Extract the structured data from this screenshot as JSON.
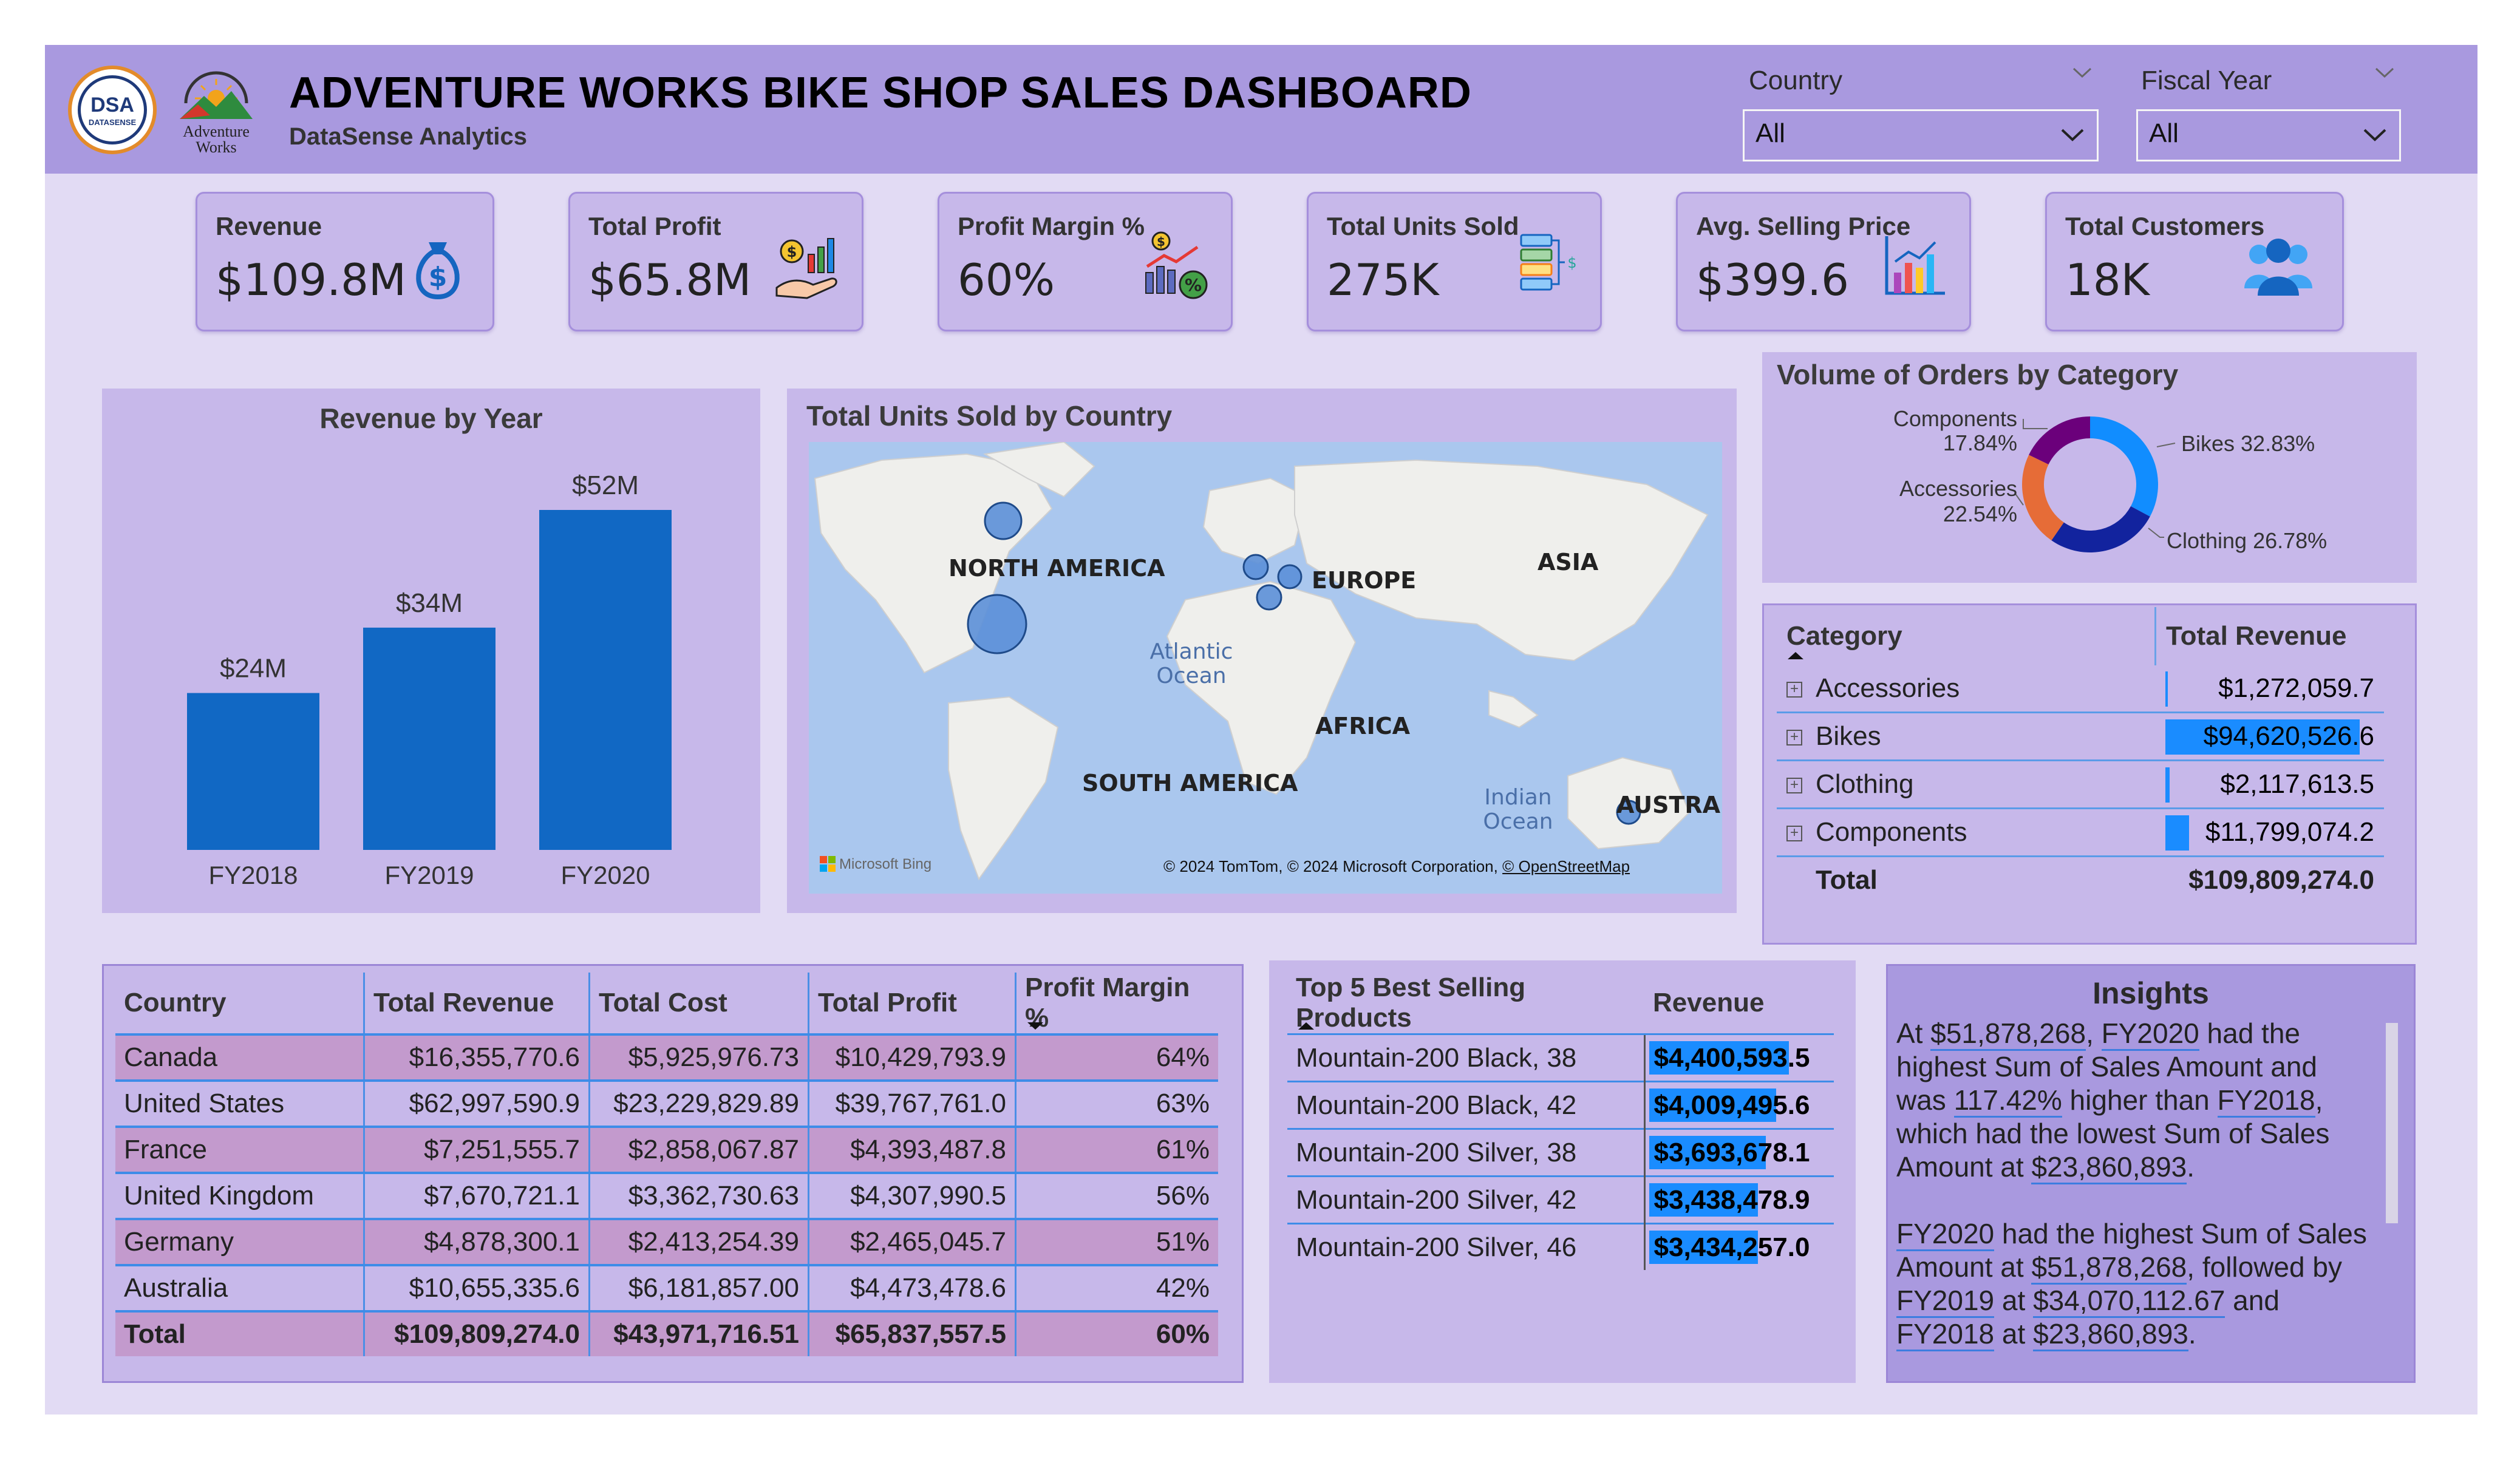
{
  "header": {
    "title": "ADVENTURE WORKS BIKE SHOP SALES DASHBOARD",
    "subtitle": "DataSense Analytics",
    "logo_dsa_text": "DSA",
    "logo_dsa_sub": "DATASENSE",
    "logo_aw_line1": "Adventure",
    "logo_aw_line2": "Works"
  },
  "slicers": {
    "country": {
      "label": "Country",
      "value": "All"
    },
    "fiscal_year": {
      "label": "Fiscal Year",
      "value": "All"
    }
  },
  "kpis": [
    {
      "label": "Revenue",
      "value": "$109.8M",
      "icon": "money-bag-icon"
    },
    {
      "label": "Total Profit",
      "value": "$65.8M",
      "icon": "profit-hand-icon"
    },
    {
      "label": "Profit Margin %",
      "value": "60%",
      "icon": "profit-margin-icon"
    },
    {
      "label": "Total Units Sold",
      "value": "275K",
      "icon": "units-stack-icon"
    },
    {
      "label": "Avg. Selling Price",
      "value": "$399.6",
      "icon": "bar-chart-icon"
    },
    {
      "label": "Total Customers",
      "value": "18K",
      "icon": "customers-icon"
    }
  ],
  "revenue_by_year": {
    "title": "Revenue by Year",
    "chart_data": {
      "type": "bar",
      "categories": [
        "FY2018",
        "FY2019",
        "FY2020"
      ],
      "values": [
        24,
        34,
        52
      ],
      "labels": [
        "$24M",
        "$34M",
        "$52M"
      ],
      "color": "#1168c4"
    }
  },
  "map": {
    "title": "Total Units Sold by Country",
    "labels": {
      "north_america": "NORTH AMERICA",
      "europe": "EUROPE",
      "asia": "ASIA",
      "africa": "AFRICA",
      "south_america": "SOUTH AMERICA",
      "australia": "AUSTRALI",
      "atlantic": "Atlantic Ocean",
      "indian": "Indian Ocean"
    },
    "attribution": "© 2024 TomTom, © 2024 Microsoft Corporation,",
    "attribution_link": "© OpenStreetMap",
    "brand": "Microsoft Bing"
  },
  "orders_by_category": {
    "title": "Volume of Orders by Category",
    "chart_data": {
      "type": "pie",
      "categories": [
        "Bikes",
        "Clothing",
        "Accessories",
        "Components"
      ],
      "values": [
        32.83,
        26.78,
        22.54,
        17.84
      ],
      "colors": [
        "#118dff",
        "#12239e",
        "#e66c37",
        "#6b007b"
      ]
    },
    "labels": {
      "bikes": "Bikes 32.83%",
      "clothing": "Clothing 26.78%",
      "accessories_name": "Accessories",
      "accessories_pct": "22.54%",
      "components_name": "Components",
      "components_pct": "17.84%"
    }
  },
  "category_table": {
    "headers": [
      "Category",
      "Total Revenue"
    ],
    "rows": [
      {
        "name": "Accessories",
        "value": "$1,272,059.7",
        "share": 1.34
      },
      {
        "name": "Bikes",
        "value": "$94,620,526.6",
        "share": 100
      },
      {
        "name": "Clothing",
        "value": "$2,117,613.5",
        "share": 2.24
      },
      {
        "name": "Components",
        "value": "$11,799,074.2",
        "share": 12.47
      }
    ],
    "total_label": "Total",
    "total_value": "$109,809,274.0"
  },
  "country_table": {
    "headers": [
      "Country",
      "Total Revenue",
      "Total Cost",
      "Total Profit",
      "Profit Margin %"
    ],
    "rows": [
      [
        "Canada",
        "$16,355,770.6",
        "$5,925,976.73",
        "$10,429,793.9",
        "64%"
      ],
      [
        "United States",
        "$62,997,590.9",
        "$23,229,829.89",
        "$39,767,761.0",
        "63%"
      ],
      [
        "France",
        "$7,251,555.7",
        "$2,858,067.87",
        "$4,393,487.8",
        "61%"
      ],
      [
        "United Kingdom",
        "$7,670,721.1",
        "$3,362,730.63",
        "$4,307,990.5",
        "56%"
      ],
      [
        "Germany",
        "$4,878,300.1",
        "$2,413,254.39",
        "$2,465,045.7",
        "51%"
      ],
      [
        "Australia",
        "$10,655,335.6",
        "$6,181,857.00",
        "$4,473,478.6",
        "42%"
      ]
    ],
    "total": [
      "Total",
      "$109,809,274.0",
      "$43,971,716.51",
      "$65,837,557.5",
      "60%"
    ]
  },
  "top_products": {
    "headers": [
      "Top 5 Best Selling Products",
      "Revenue"
    ],
    "rows": [
      {
        "name": "Mountain-200 Black, 38",
        "value": "$4,400,593.5",
        "share": 100
      },
      {
        "name": "Mountain-200 Black, 42",
        "value": "$4,009,495.6",
        "share": 91.1
      },
      {
        "name": "Mountain-200 Silver, 38",
        "value": "$3,693,678.1",
        "share": 83.9
      },
      {
        "name": "Mountain-200 Silver, 42",
        "value": "$3,438,478.9",
        "share": 78.1
      },
      {
        "name": "Mountain-200 Silver, 46",
        "value": "$3,434,257.0",
        "share": 78.0
      }
    ]
  },
  "insights": {
    "title": "Insights",
    "p1": {
      "a": "At ",
      "v1": "$51,878,268",
      "b": ", ",
      "v2": "FY2020",
      "c": " had the highest Sum of Sales Amount and was ",
      "v3": "117.42%",
      "d": " higher than ",
      "v4": "FY2018",
      "e": ", which had the lowest Sum of Sales Amount at ",
      "v5": "$23,860,893",
      "f": "."
    },
    "p2": {
      "v1": "FY2020",
      "a": " had the highest Sum of Sales Amount at ",
      "v2": "$51,878,268",
      "b": ", followed by ",
      "v3": "FY2019",
      "c": " at ",
      "v4": "$34,070,112.67",
      "d": " and ",
      "v5": "FY2018",
      "e": " at ",
      "v6": "$23,860,893",
      "f": "."
    }
  }
}
